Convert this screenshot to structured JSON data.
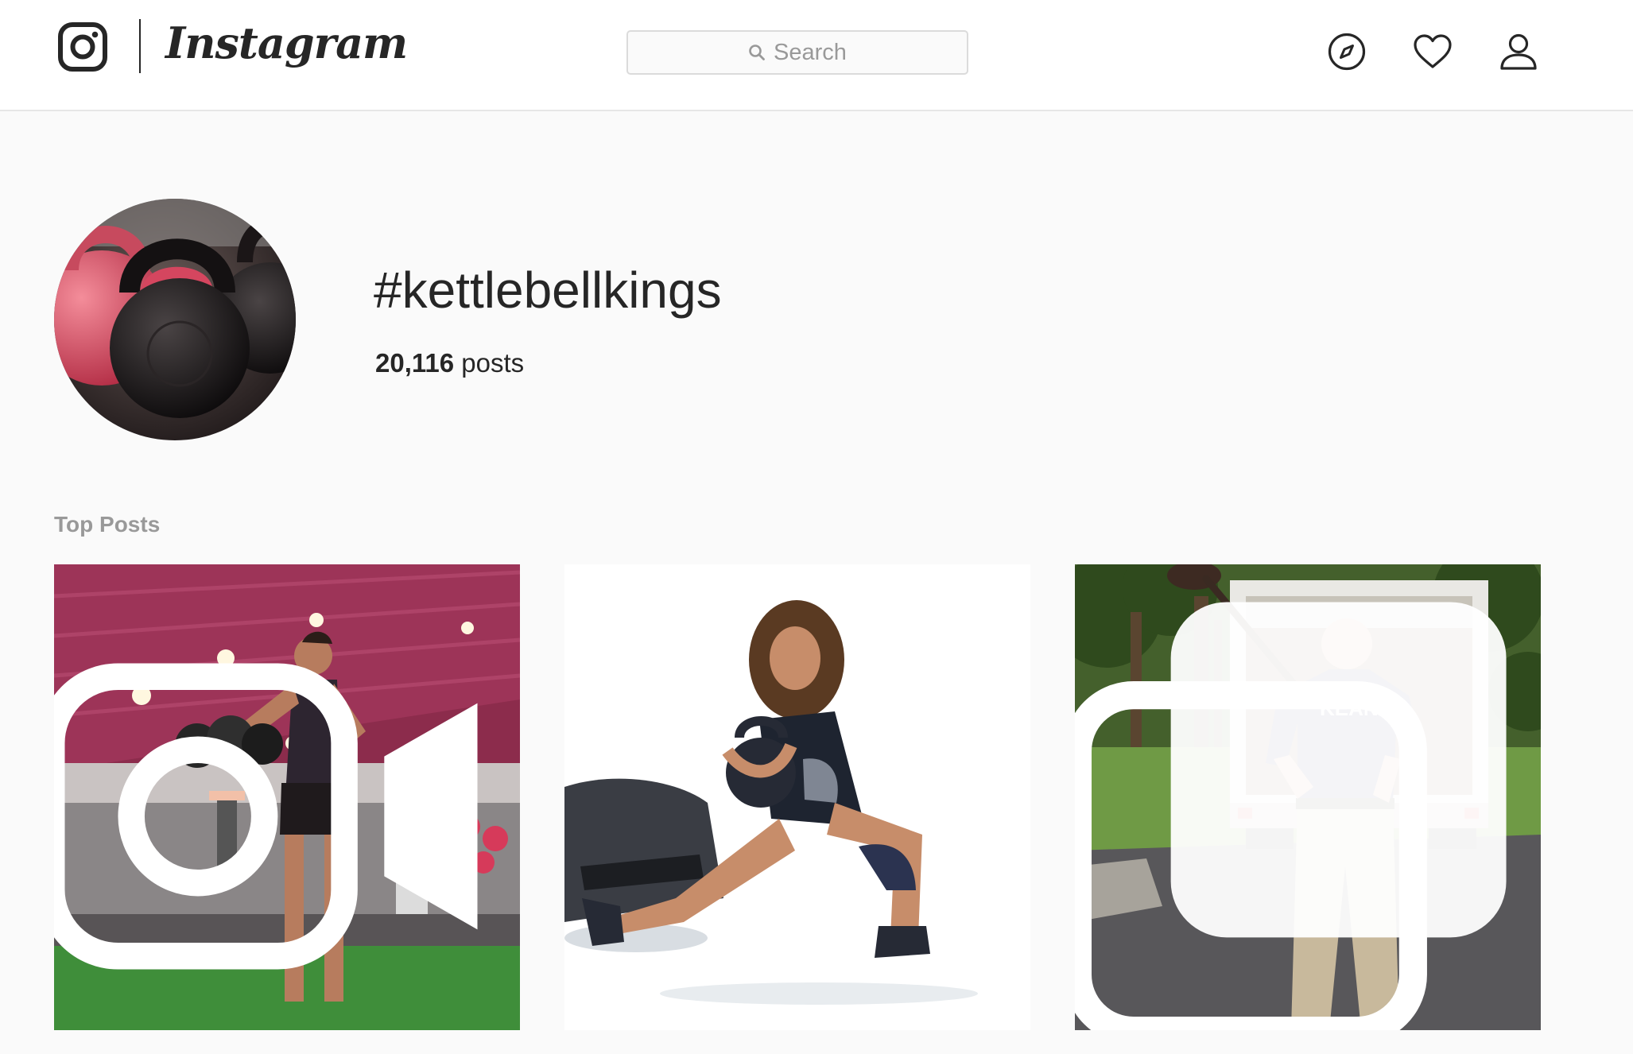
{
  "header": {
    "brand": "Instagram",
    "search_placeholder": "Search",
    "nav_icons": [
      "compass-icon",
      "heart-icon",
      "user-icon"
    ]
  },
  "hashtag": {
    "title": "#kettlebellkings",
    "post_count": "20,116",
    "post_count_label": "posts"
  },
  "sections": {
    "top_posts_label": "Top Posts"
  },
  "posts": [
    {
      "media_type": "igtv-video",
      "badge_icon": "igtv-icon"
    },
    {
      "media_type": "image"
    },
    {
      "media_type": "carousel",
      "badge_icon": "carousel-icon"
    }
  ],
  "colors": {
    "background": "#fafafa",
    "header_bg": "#ffffff",
    "border": "#dbdbdb",
    "text_primary": "#262626",
    "text_secondary": "#999999"
  }
}
